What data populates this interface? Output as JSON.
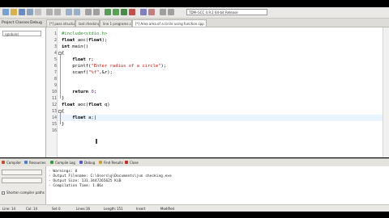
{
  "toolbar": {
    "compiler_select": "TDM-GCC 4.9.2 64-bit Release",
    "globals_select": "(globals)"
  },
  "file_tabs": [
    {
      "label": "[*] pass structure to fn .cpp"
    },
    {
      "label": "last checking.cpp"
    },
    {
      "label": "line 1 programs.cpp"
    },
    {
      "label": "[*] Area area of a circle using function.cpp"
    }
  ],
  "left_tabs": [
    "Project",
    "Classes",
    "Debug"
  ],
  "class_field": "(globals)",
  "editor": {
    "lines": [
      {
        "no": "1",
        "html": "<span class='pp'>#include&lt;stdio.h&gt;</span>"
      },
      {
        "no": "2",
        "html": "<span class='kw'>float</span> aoc(<span class='kw'>float</span>);"
      },
      {
        "no": "3",
        "html": "<span class='kw'>int</span> main()"
      },
      {
        "no": "4",
        "html": "{"
      },
      {
        "no": "5",
        "html": "    <span class='kw'>float</span> r;"
      },
      {
        "no": "6",
        "html": "    printf(<span class='str'>\"Enter radius of a circle\"</span>);"
      },
      {
        "no": "7",
        "html": "    scanf(<span class='str'>\"%f\"</span>,&amp;r);"
      },
      {
        "no": "8",
        "html": ""
      },
      {
        "no": "9",
        "html": ""
      },
      {
        "no": "10",
        "html": "    <span class='kw'>return</span> <span class='num'>0</span>;"
      },
      {
        "no": "11",
        "html": "}"
      },
      {
        "no": "12",
        "html": "<span class='kw'>float</span> aoc(<span class='kw'>float</span> q)"
      },
      {
        "no": "13",
        "html": "{"
      },
      {
        "no": "14",
        "html": "    <span class='kw'>float</span> a;|"
      },
      {
        "no": "15",
        "html": "}"
      },
      {
        "no": "16",
        "html": ""
      }
    ]
  },
  "bottom_tabs": [
    {
      "label": "Compiler",
      "color": "#c94a2a"
    },
    {
      "label": "Resources",
      "color": "#4a7fc9"
    },
    {
      "label": "Compile Log",
      "color": "#3a9a3a"
    },
    {
      "label": "Debug",
      "color": "#5a5ac9"
    },
    {
      "label": "Find Results",
      "color": "#c9a02a"
    },
    {
      "label": "Close",
      "color": "#c92a2a"
    }
  ],
  "left_bottom": {
    "shorten_paths_label": "Shorten compiler paths"
  },
  "log": [
    "- Warnings: 0",
    "- Output Filename: C:\\Users\\g\\Documents\\jun checking.exe",
    "- Output Size: 131.3447265625 KiB",
    "- Compilation Time: 1.06s"
  ],
  "status": {
    "line_label": "Line:",
    "line_value": "14",
    "col_label": "Col:",
    "col_value": "14",
    "sel_label": "Sel:",
    "sel_value": "0",
    "lines_label": "Lines:",
    "lines_value": "16",
    "length_label": "Length:",
    "length_value": "151",
    "insert_label": "Insert",
    "modified_label": "Modified"
  }
}
